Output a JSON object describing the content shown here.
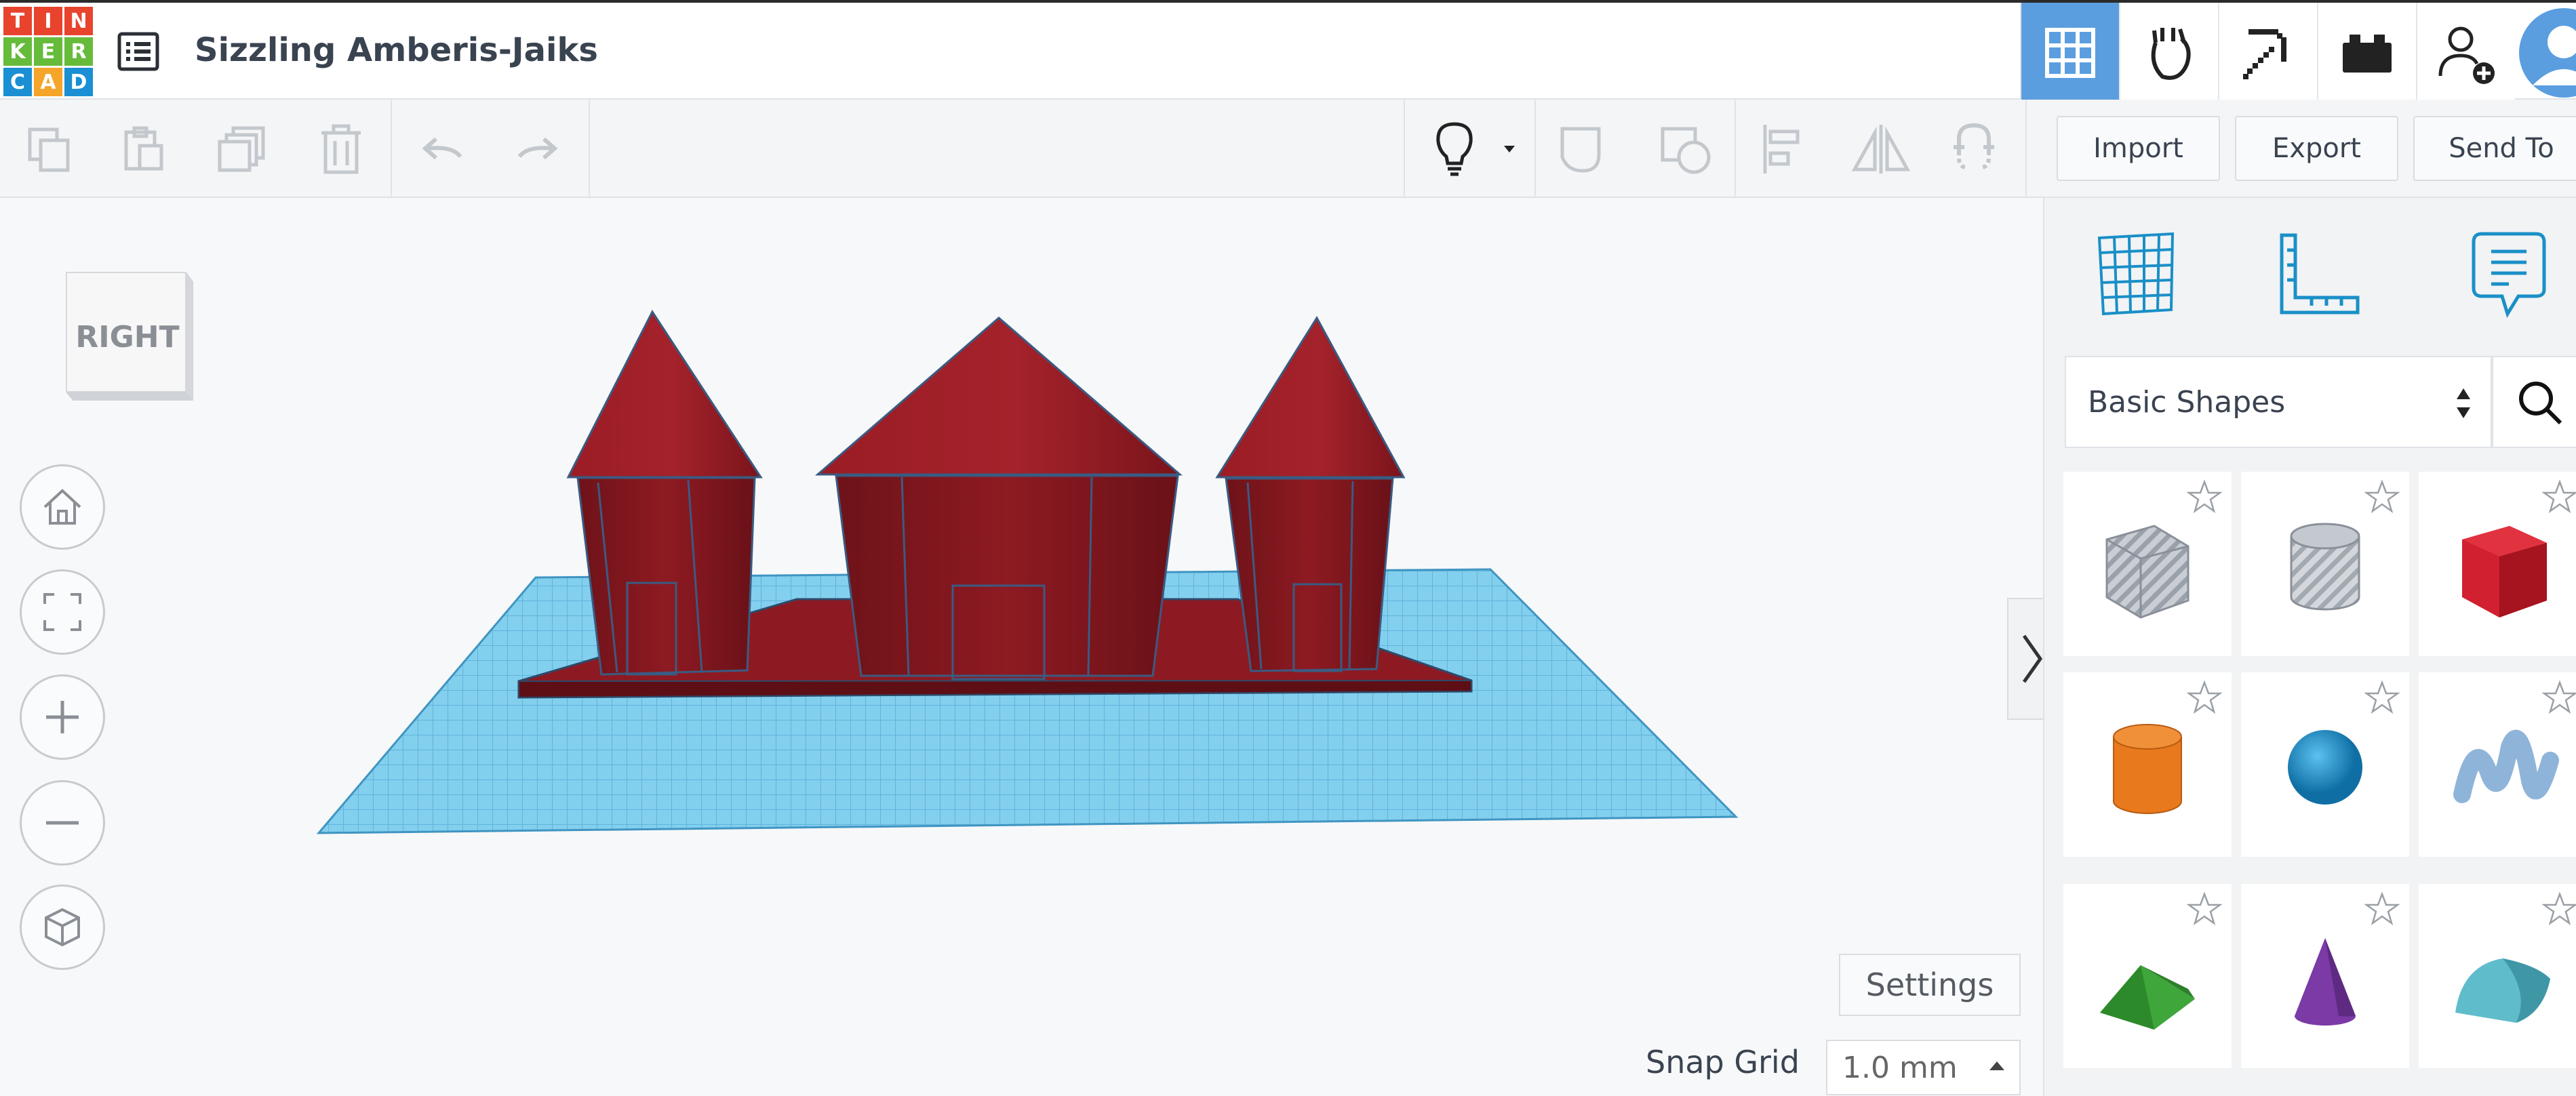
{
  "app": {
    "logo_letters": [
      "T",
      "I",
      "N",
      "K",
      "E",
      "R",
      "C",
      "A",
      "D"
    ],
    "logo_colors": [
      "#e8432d",
      "#e8432d",
      "#e8432d",
      "#66bb3b",
      "#66bb3b",
      "#66bb3b",
      "#1a8fd4",
      "#f4a52a",
      "#1a8fd4"
    ],
    "design_title": "Sizzling Amberis-Jaiks"
  },
  "top_icons": [
    {
      "name": "3d-design-view-icon",
      "active": true
    },
    {
      "name": "circuits-view-icon",
      "active": false
    },
    {
      "name": "minecraft-pickaxe-icon",
      "active": false
    },
    {
      "name": "bricks-view-icon",
      "active": false
    },
    {
      "name": "add-collaborator-icon",
      "active": false
    }
  ],
  "toolbar": {
    "import_label": "Import",
    "export_label": "Export",
    "send_to_label": "Send To"
  },
  "viewport": {
    "view_cube_face": "RIGHT",
    "settings_label": "Settings",
    "snap_grid_label": "Snap Grid",
    "snap_grid_value": "1.0 mm"
  },
  "panel": {
    "category_value": "Basic Shapes",
    "shapes": [
      {
        "name": "box-hole",
        "color": "#b8bec6"
      },
      {
        "name": "cylinder-hole",
        "color": "#c2c7cd"
      },
      {
        "name": "box",
        "color": "#d1202f"
      },
      {
        "name": "cylinder",
        "color": "#e8791d"
      },
      {
        "name": "sphere",
        "color": "#1a9ad6"
      },
      {
        "name": "scribble",
        "color": "#8fb4d9"
      },
      {
        "name": "roof",
        "color": "#3ea63a"
      },
      {
        "name": "cone",
        "color": "#7b3aa6"
      },
      {
        "name": "round-roof",
        "color": "#5fbccb"
      }
    ]
  },
  "colors": {
    "accent": "#5a9ee0",
    "model_red": "#8b1820",
    "workplane_blue": "#7ccbea"
  }
}
